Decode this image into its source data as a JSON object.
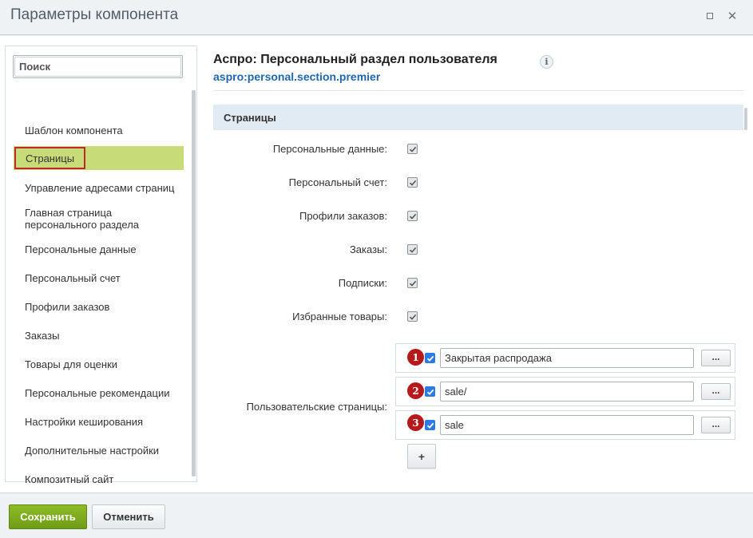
{
  "window": {
    "title": "Параметры компонента"
  },
  "sidebar": {
    "search_placeholder": "Поиск",
    "items": [
      {
        "label": "Шаблон компонента"
      },
      {
        "label": "Страницы",
        "active": true
      },
      {
        "label": "Управление адресами страниц"
      },
      {
        "label": "Главная страница\nперсонального раздела"
      },
      {
        "label": "Персональные данные"
      },
      {
        "label": "Персональный счет"
      },
      {
        "label": "Профили заказов"
      },
      {
        "label": "Заказы"
      },
      {
        "label": "Товары для оценки"
      },
      {
        "label": "Персональные рекомендации"
      },
      {
        "label": "Настройки кеширования"
      },
      {
        "label": "Дополнительные настройки"
      },
      {
        "label": "Композитный сайт"
      }
    ]
  },
  "main": {
    "component_title": "Аспро: Персональный раздел пользователя",
    "info_icon_glyph": "i",
    "component_code": "aspro:personal.section.premier",
    "section_title": "Страницы",
    "checkbox_rows": [
      {
        "label": "Персональные данные:",
        "checked": true
      },
      {
        "label": "Персональный счет:",
        "checked": true
      },
      {
        "label": "Профили заказов:",
        "checked": true
      },
      {
        "label": "Заказы:",
        "checked": true
      },
      {
        "label": "Подписки:",
        "checked": true
      },
      {
        "label": "Избранные товары:",
        "checked": true
      }
    ],
    "user_pages": {
      "label": "Пользовательские страницы:",
      "rows": [
        {
          "badge": "1",
          "checked": true,
          "value": "Закрытая распродажа",
          "button": "..."
        },
        {
          "badge": "2",
          "checked": true,
          "value": "sale/",
          "button": "..."
        },
        {
          "badge": "3",
          "checked": true,
          "value": "sale",
          "button": "..."
        }
      ],
      "add_button": "+"
    }
  },
  "footer": {
    "save_label": "Сохранить",
    "cancel_label": "Отменить"
  },
  "colors": {
    "accent_green": "#7aa81c",
    "active_item": "#c7dc79",
    "badge_red": "#b5191c",
    "link_blue": "#2067b0",
    "section_bar": "#e1ebf3"
  }
}
